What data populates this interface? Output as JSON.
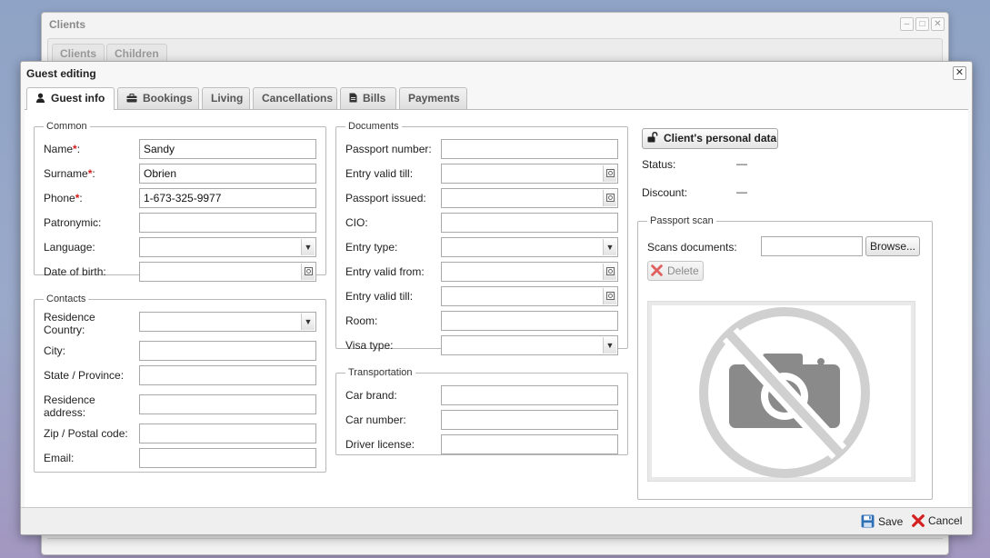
{
  "background_window": {
    "title": "Clients",
    "tabs": [
      "Clients",
      "Children"
    ],
    "controls": {
      "minimize": "–",
      "maximize": "□",
      "close": "✕"
    }
  },
  "dialog": {
    "title": "Guest editing",
    "close_glyph": "✕",
    "tabs": [
      {
        "label": "Guest info",
        "icon": "user-icon",
        "active": true
      },
      {
        "label": "Bookings",
        "icon": "briefcase-icon",
        "active": false
      },
      {
        "label": "Living",
        "icon": "",
        "active": false
      },
      {
        "label": "Cancellations",
        "icon": "",
        "active": false
      },
      {
        "label": "Bills",
        "icon": "document-icon",
        "active": false
      },
      {
        "label": "Payments",
        "icon": "",
        "active": false
      }
    ]
  },
  "common": {
    "legend": "Common",
    "required_mark": "*",
    "name_label": "Name",
    "name_value": "Sandy",
    "surname_label": "Surname",
    "surname_value": "Obrien",
    "phone_label": "Phone",
    "phone_value": "1-673-325-9977",
    "patronymic_label": "Patronymic:",
    "patronymic_value": "",
    "language_label": "Language:",
    "language_value": "",
    "dob_label": "Date of birth:",
    "dob_value": ""
  },
  "contacts": {
    "legend": "Contacts",
    "country_label_1": "Residence",
    "country_label_2": "Country:",
    "country_value": "",
    "city_label": "City:",
    "city_value": "",
    "state_label": "State / Province:",
    "state_value": "",
    "address_label_1": "Residence",
    "address_label_2": "address:",
    "address_value": "",
    "zip_label": "Zip / Postal code:",
    "zip_value": "",
    "email_label": "Email:",
    "email_value": ""
  },
  "documents": {
    "legend": "Documents",
    "passport_number_label": "Passport number:",
    "entry_valid_till_label": "Entry valid till:",
    "passport_issued_label": "Passport issued:",
    "cio_label": "CIO:",
    "entry_type_label": "Entry type:",
    "entry_valid_from_label": "Entry valid from:",
    "entry_valid_till2_label": "Entry valid till:",
    "room_label": "Room:",
    "visa_type_label": "Visa type:"
  },
  "transportation": {
    "legend": "Transportation",
    "car_brand_label": "Car brand:",
    "car_number_label": "Car number:",
    "driver_license_label": "Driver license:"
  },
  "personal": {
    "button_label": "Client's personal data",
    "status_label": "Status:",
    "status_value": "—",
    "discount_label": "Discount:",
    "discount_value": "—"
  },
  "passport_scan": {
    "legend": "Passport scan",
    "scans_label": "Scans documents:",
    "scans_value": "",
    "browse_label": "Browse...",
    "delete_label": "Delete"
  },
  "footer": {
    "save_label": "Save",
    "cancel_label": "Cancel"
  },
  "colors": {
    "required": "#d21a1a",
    "delete_icon": "#e06060",
    "cancel_icon": "#d42020",
    "save_icon": "#2f6fb5",
    "placeholder_graphic": "#d0d0d0",
    "camera": "#8a8a8a"
  }
}
